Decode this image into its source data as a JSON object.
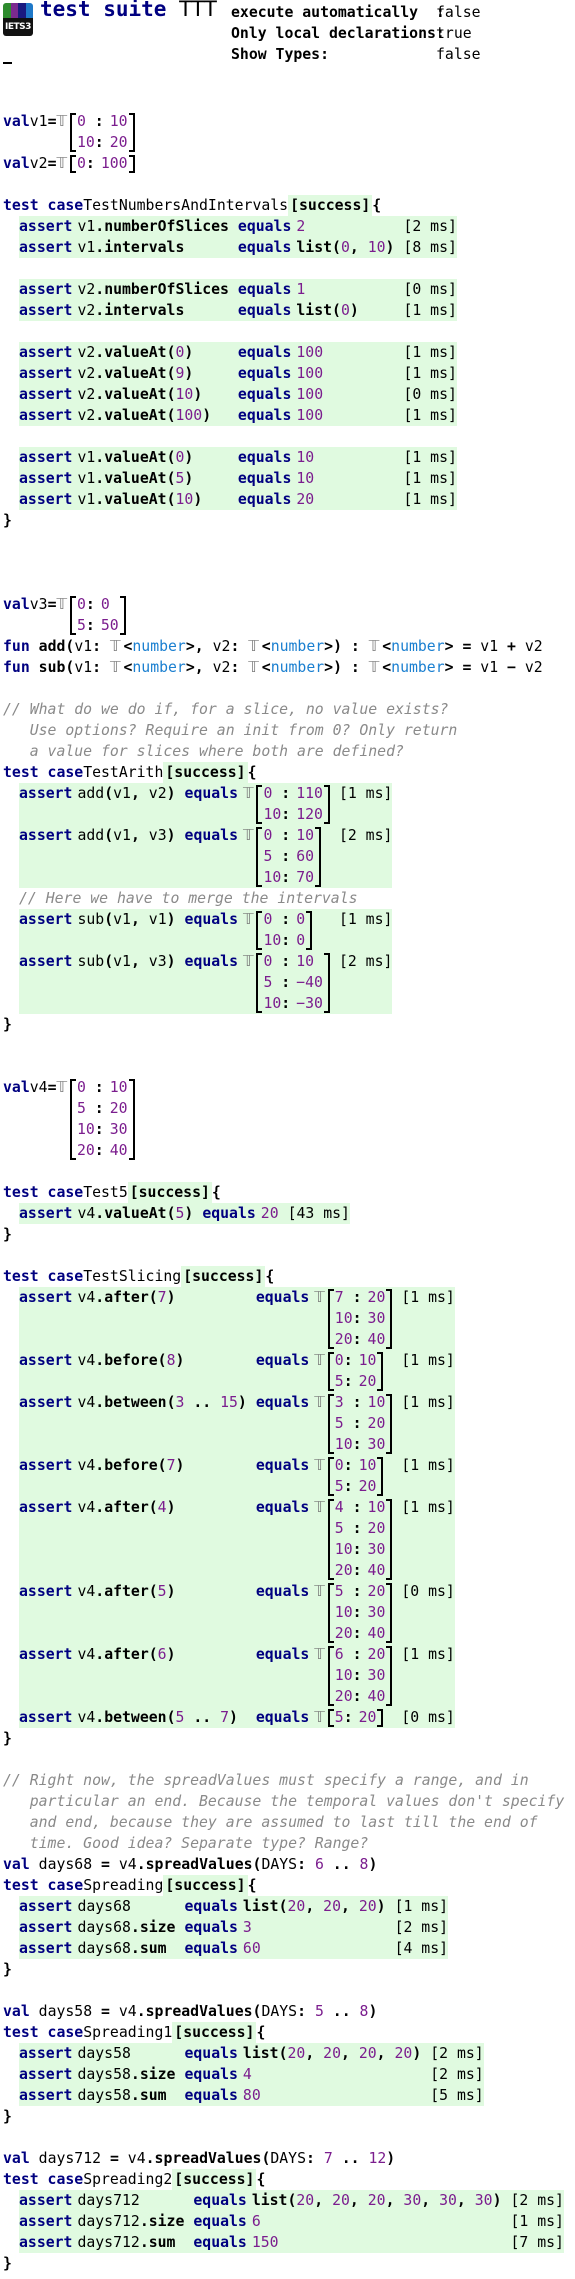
{
  "header": {
    "logo_text": "IETS3",
    "logo_colors": [
      "#2e8b2e",
      "#7b2a8f",
      "#1a1a80",
      "#1e78c8"
    ],
    "title_keyword": "test suite",
    "title_name": "TTT",
    "settings": [
      {
        "label": "execute automatically  :",
        "value": "false"
      },
      {
        "label": "Only local declarations:",
        "value": "true"
      },
      {
        "label": "Show Types:",
        "value": "false"
      }
    ]
  },
  "status_color": "#e0fae0",
  "items": [
    {
      "type": "val",
      "name": "v1",
      "table": [
        [
          "0",
          "10"
        ],
        [
          "10",
          "20"
        ]
      ]
    },
    {
      "type": "val",
      "name": "v2",
      "table": [
        [
          "0",
          "100"
        ]
      ]
    },
    {
      "type": "blank"
    },
    {
      "type": "testcase",
      "name": "TestNumbersAndIntervals",
      "status": "[success]",
      "rows": [
        {
          "subject": "v1.numberOfSlices",
          "expected": "2",
          "time": "[2 ms]"
        },
        {
          "subject": "v1.intervals",
          "expected": "list(0, 10)",
          "time": "[8 ms]"
        },
        {
          "blank": true
        },
        {
          "subject": "v2.numberOfSlices",
          "expected": "1",
          "time": "[0 ms]"
        },
        {
          "subject": "v2.intervals",
          "expected": "list(0)",
          "time": "[1 ms]"
        },
        {
          "blank": true
        },
        {
          "subject": "v2.valueAt(0)",
          "expected": "100",
          "time": "[1 ms]"
        },
        {
          "subject": "v2.valueAt(9)",
          "expected": "100",
          "time": "[1 ms]"
        },
        {
          "subject": "v2.valueAt(10)",
          "expected": "100",
          "time": "[0 ms]"
        },
        {
          "subject": "v2.valueAt(100)",
          "expected": "100",
          "time": "[1 ms]"
        },
        {
          "blank": true
        },
        {
          "subject": "v1.valueAt(0)",
          "expected": "10",
          "time": "[1 ms]"
        },
        {
          "subject": "v1.valueAt(5)",
          "expected": "10",
          "time": "[1 ms]"
        },
        {
          "subject": "v1.valueAt(10)",
          "expected": "20",
          "time": "[1 ms]"
        }
      ]
    },
    {
      "type": "blank"
    },
    {
      "type": "blank"
    },
    {
      "type": "blank"
    },
    {
      "type": "val",
      "name": "v3",
      "table": [
        [
          "0",
          "0"
        ],
        [
          "5",
          "50"
        ]
      ]
    },
    {
      "type": "code",
      "text": "fun add(v1: 𝕋<number>, v2: 𝕋<number>) : 𝕋<number> = v1 + v2"
    },
    {
      "type": "code",
      "text": "fun sub(v1: 𝕋<number>, v2: 𝕋<number>) : 𝕋<number> = v1 − v2"
    },
    {
      "type": "blank"
    },
    {
      "type": "comment",
      "text": "// What do we do if, for a slice, no value exists?"
    },
    {
      "type": "comment",
      "text": "   Use options? Require an init from 0? Only return"
    },
    {
      "type": "comment",
      "text": "   a value for slices where both are defined?"
    },
    {
      "type": "testcase",
      "name": "TestArith",
      "status": "[success]",
      "rows": [
        {
          "subject": "add(v1, v2)",
          "table": [
            [
              "0",
              "110"
            ],
            [
              "10",
              "120"
            ]
          ],
          "time": "[1 ms]"
        },
        {
          "subject": "add(v1, v3)",
          "table": [
            [
              "0",
              "10"
            ],
            [
              "5",
              "60"
            ],
            [
              "10",
              "70"
            ]
          ],
          "time": "[2 ms]"
        },
        {
          "comment": "// Here we have to merge the intervals"
        },
        {
          "subject": "sub(v1, v1)",
          "table": [
            [
              "0",
              "0"
            ],
            [
              "10",
              "0"
            ]
          ],
          "time": "[1 ms]"
        },
        {
          "subject": "sub(v1, v3)",
          "table": [
            [
              "0",
              "10"
            ],
            [
              "5",
              "−40"
            ],
            [
              "10",
              "−30"
            ]
          ],
          "time": "[2 ms]"
        }
      ]
    },
    {
      "type": "blank"
    },
    {
      "type": "blank"
    },
    {
      "type": "val",
      "name": "v4",
      "table": [
        [
          "0",
          "10"
        ],
        [
          "5",
          "20"
        ],
        [
          "10",
          "30"
        ],
        [
          "20",
          "40"
        ]
      ]
    },
    {
      "type": "blank"
    },
    {
      "type": "testcase",
      "name": "Test5",
      "status": "[success]",
      "rows": [
        {
          "subject": "v4.valueAt(5)",
          "expected": "20",
          "time": "[43 ms]"
        }
      ]
    },
    {
      "type": "blank"
    },
    {
      "type": "testcase",
      "name": "TestSlicing",
      "status": "[success]",
      "rows": [
        {
          "subject": "v4.after(7)",
          "table": [
            [
              "7",
              "20"
            ],
            [
              "10",
              "30"
            ],
            [
              "20",
              "40"
            ]
          ],
          "time": "[1 ms]"
        },
        {
          "subject": "v4.before(8)",
          "table": [
            [
              "0",
              "10"
            ],
            [
              "5",
              "20"
            ]
          ],
          "time": "[1 ms]"
        },
        {
          "subject": "v4.between(3 .. 15)",
          "table": [
            [
              "3",
              "10"
            ],
            [
              "5",
              "20"
            ],
            [
              "10",
              "30"
            ]
          ],
          "time": "[1 ms]"
        },
        {
          "subject": "v4.before(7)",
          "table": [
            [
              "0",
              "10"
            ],
            [
              "5",
              "20"
            ]
          ],
          "time": "[1 ms]"
        },
        {
          "subject": "v4.after(4)",
          "table": [
            [
              "4",
              "10"
            ],
            [
              "5",
              "20"
            ],
            [
              "10",
              "30"
            ],
            [
              "20",
              "40"
            ]
          ],
          "time": "[1 ms]"
        },
        {
          "subject": "v4.after(5)",
          "table": [
            [
              "5",
              "20"
            ],
            [
              "10",
              "30"
            ],
            [
              "20",
              "40"
            ]
          ],
          "time": "[0 ms]"
        },
        {
          "subject": "v4.after(6)",
          "table": [
            [
              "6",
              "20"
            ],
            [
              "10",
              "30"
            ],
            [
              "20",
              "40"
            ]
          ],
          "time": "[1 ms]"
        },
        {
          "subject": "v4.between(5 .. 7)",
          "table": [
            [
              "5",
              "20"
            ]
          ],
          "time": "[0 ms]"
        }
      ]
    },
    {
      "type": "blank"
    },
    {
      "type": "comment",
      "text": "// Right now, the spreadValues must specify a range, and in"
    },
    {
      "type": "comment",
      "text": "   particular an end. Because the temporal values don't specify"
    },
    {
      "type": "comment",
      "text": "   and end, because they are assumed to last till the end of"
    },
    {
      "type": "comment",
      "text": "   time. Good idea? Separate type? Range?"
    },
    {
      "type": "code",
      "text": "val days68 = v4.spreadValues(DAYS: 6 .. 8)"
    },
    {
      "type": "testcase",
      "name": "Spreading",
      "status": "[success]",
      "rows": [
        {
          "subject": "days68",
          "expected": "list(20, 20, 20)",
          "time": "[1 ms]"
        },
        {
          "subject": "days68.size",
          "expected": "3",
          "time": "[2 ms]"
        },
        {
          "subject": "days68.sum",
          "expected": "60",
          "time": "[4 ms]"
        }
      ]
    },
    {
      "type": "blank"
    },
    {
      "type": "code",
      "text": "val days58 = v4.spreadValues(DAYS: 5 .. 8)"
    },
    {
      "type": "testcase",
      "name": "Spreading1",
      "status": "[success]",
      "rows": [
        {
          "subject": "days58",
          "expected": "list(20, 20, 20, 20)",
          "time": "[2 ms]"
        },
        {
          "subject": "days58.size",
          "expected": "4",
          "time": "[2 ms]"
        },
        {
          "subject": "days58.sum",
          "expected": "80",
          "time": "[5 ms]"
        }
      ]
    },
    {
      "type": "blank"
    },
    {
      "type": "code",
      "text": "val days712 = v4.spreadValues(DAYS: 7 .. 12)"
    },
    {
      "type": "testcase",
      "name": "Spreading2",
      "status": "[success]",
      "rows": [
        {
          "subject": "days712",
          "expected": "list(20, 20, 20, 30, 30, 30)",
          "time": "[2 ms]"
        },
        {
          "subject": "days712.size",
          "expected": "6",
          "time": "[1 ms]"
        },
        {
          "subject": "days712.sum",
          "expected": "150",
          "time": "[7 ms]"
        }
      ]
    }
  ],
  "tokens": {
    "val": "val",
    "test_case": "test case",
    "assert": "assert",
    "equals": "equals",
    "open": "{",
    "close": "}",
    "eq": "=",
    "table_prefix": "𝕋"
  }
}
